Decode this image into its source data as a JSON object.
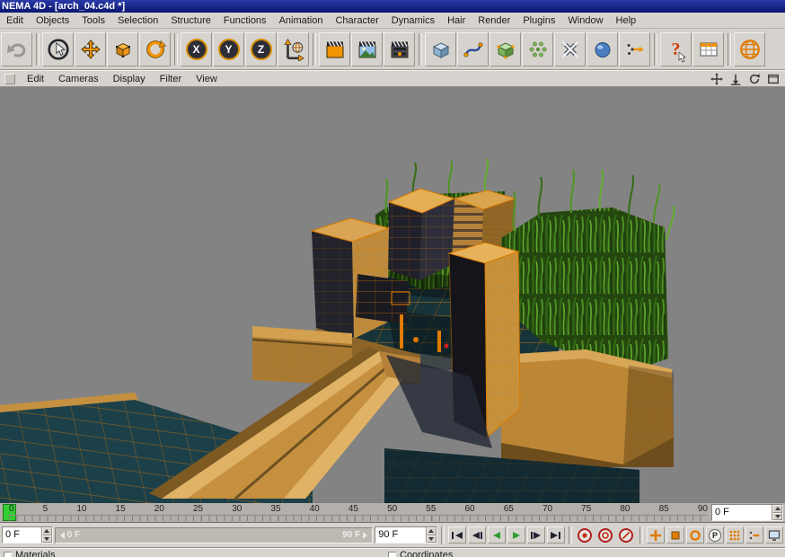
{
  "window": {
    "title": "NEMA 4D - [arch_04.c4d *]"
  },
  "menu_bar": {
    "items": [
      "Edit",
      "Objects",
      "Tools",
      "Selection",
      "Structure",
      "Functions",
      "Animation",
      "Character",
      "Dynamics",
      "Hair",
      "Render",
      "Plugins",
      "Window",
      "Help"
    ]
  },
  "toolbar": {
    "axis_x": "X",
    "axis_y": "Y",
    "axis_z": "Z",
    "help_label": "?",
    "icons": [
      "undo-icon",
      "live-selection-icon",
      "move-tool-icon",
      "scale-tool-icon",
      "rotate-tool-icon",
      "lock-x-icon",
      "lock-y-icon",
      "lock-z-icon",
      "coordinate-system-icon",
      "render-view-icon",
      "render-picture-viewer-icon",
      "render-settings-icon",
      "add-cube-icon",
      "add-spline-icon",
      "add-instance-icon",
      "add-array-icon",
      "add-deformer-icon",
      "add-environment-icon",
      "add-particles-icon",
      "help-icon",
      "layout-icon",
      "online-globe-icon"
    ]
  },
  "viewport_bar": {
    "menus": [
      "Edit",
      "Cameras",
      "Display",
      "Filter",
      "View"
    ],
    "icons": [
      "pan-view-icon",
      "zoom-view-icon",
      "rotate-view-icon",
      "maximize-view-icon"
    ]
  },
  "timeline": {
    "ticks": [
      "0",
      "5",
      "10",
      "15",
      "20",
      "25",
      "30",
      "35",
      "40",
      "45",
      "50",
      "55",
      "60",
      "65",
      "70",
      "75",
      "80",
      "85",
      "90"
    ],
    "frame_spinner_value": "0 F"
  },
  "transport": {
    "start_spinner_value": "0 F",
    "range_start_label": "0 F",
    "range_end_label": "90 F",
    "end_spinner_value": "90 F",
    "parameter_label": "P"
  },
  "status_panels": {
    "materials_label": "Materials",
    "coordinates_label": "Coordinates"
  },
  "colors": {
    "title_blue": "#12228c",
    "chrome_gray": "#d6d3ce",
    "viewport_gray": "#838383",
    "accent_orange": "#e07b00",
    "ground_teal": "#17343b",
    "grass_green": "#3f7a1f",
    "playhead_green": "#33cc33"
  }
}
